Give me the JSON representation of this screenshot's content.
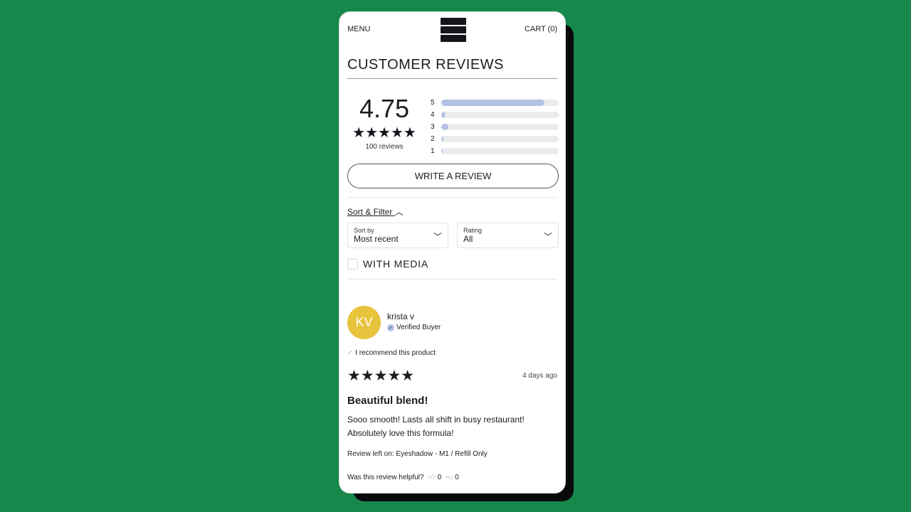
{
  "header": {
    "menu": "MENU",
    "cart": "CART (0)",
    "logo_text": "MOB"
  },
  "title": "CUSTOMER REVIEWS",
  "summary": {
    "average": "4.75",
    "stars": "★★★★★",
    "count": "100 reviews",
    "distribution": [
      {
        "label": "5",
        "percent": 88
      },
      {
        "label": "4",
        "percent": 3
      },
      {
        "label": "3",
        "percent": 6
      },
      {
        "label": "2",
        "percent": 2
      },
      {
        "label": "1",
        "percent": 1
      }
    ]
  },
  "write_review": "WRITE A REVIEW",
  "sort_filter": "Sort & Filter",
  "sort": {
    "label": "Sort by",
    "value": "Most recent"
  },
  "rating": {
    "label": "Rating",
    "value": "All"
  },
  "with_media": "WITH MEDIA",
  "review": {
    "initials": "KV",
    "name": "krista v",
    "verified": "Verified Buyer",
    "recommend": "I recommend this product",
    "stars": "★★★★★",
    "date": "4 days ago",
    "title": "Beautiful blend!",
    "body": "Sooo smooth! Lasts all shift in busy restaurant! Absolutely love this formula!",
    "product": "Review left on: Eyeshadow - M1 / Refill Only",
    "helpful": "Was this review helpful?",
    "up": "0",
    "down": "0"
  },
  "colors": {
    "background": "#16884c",
    "bar_fill": "#b3c2e5",
    "avatar": "#e8c33c"
  }
}
